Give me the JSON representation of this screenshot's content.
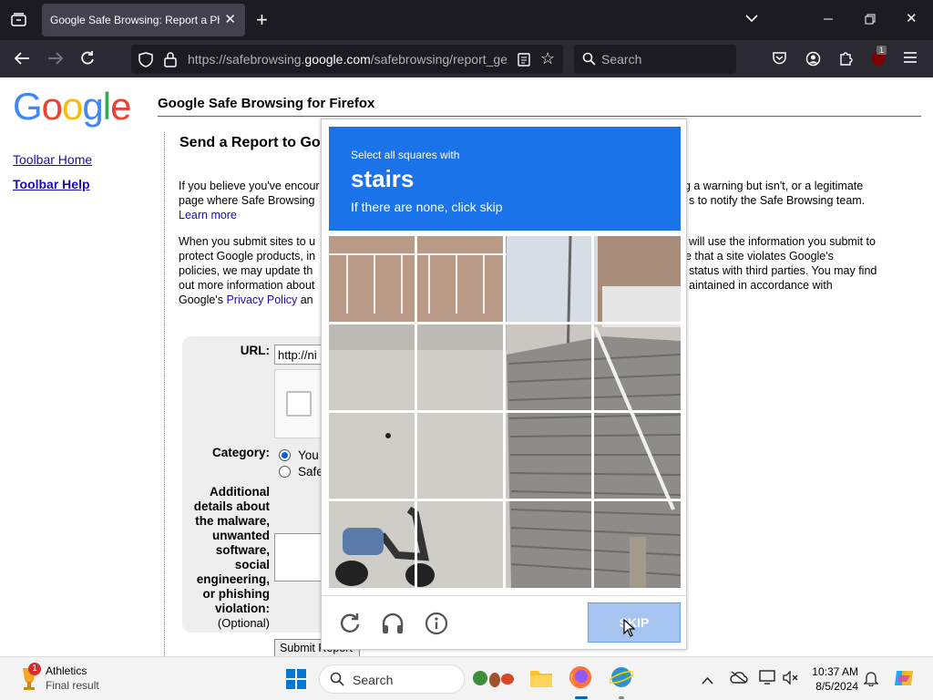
{
  "browser": {
    "tab_title": "Google Safe Browsing: Report a Phi",
    "url_prefix": "https://safebrowsing.",
    "url_domain": "google.com",
    "url_suffix": "/safebrowsing/report_gen",
    "search_placeholder": "Search",
    "extension_badge": "1"
  },
  "page": {
    "logo": "Google",
    "header": "Google Safe Browsing for Firefox",
    "sidebar_links": [
      "Toolbar Home",
      "Toolbar Help"
    ],
    "heading": "Send a Report to Go",
    "para1_a": "If you believe you've encour",
    "para1_b": "ng a warning but isn't, or a legitimate",
    "para1_c": "page where Safe Browsing",
    "para1_d": "s to notify the Safe Browsing team.",
    "learn_more": "Learn more",
    "para2_a": "When you submit sites to u",
    "para2_b": "will use the information you submit to",
    "para2_c": "protect Google products, in",
    "para2_d": "e that a site violates Google's",
    "para2_e": "policies, we may update th",
    "para2_f": "status with third parties. You may find",
    "para2_g": "out more information about",
    "para2_h": "aintained in accordance with",
    "para2_i": "Google's",
    "privacy_policy": "Privacy Policy",
    "para2_j": "an",
    "url_label": "URL:",
    "url_value": "http://ni",
    "category_label": "Category:",
    "category_opt1": "You",
    "category_opt2": "Safe",
    "details_label": "Additional details about the malware, unwanted software, social engineering, or phishing violation:",
    "optional": "(Optional)",
    "submit": "Submit Report"
  },
  "captcha": {
    "line1": "Select all squares with",
    "target": "stairs",
    "line3": "If there are none, click skip",
    "skip_label": "SKIP",
    "header_color": "#1a73e8"
  },
  "taskbar": {
    "weather_badge": "1",
    "weather_title": "Athletics",
    "weather_sub": "Final result",
    "search": "Search",
    "time": "10:37 AM",
    "date": "8/5/2024"
  }
}
